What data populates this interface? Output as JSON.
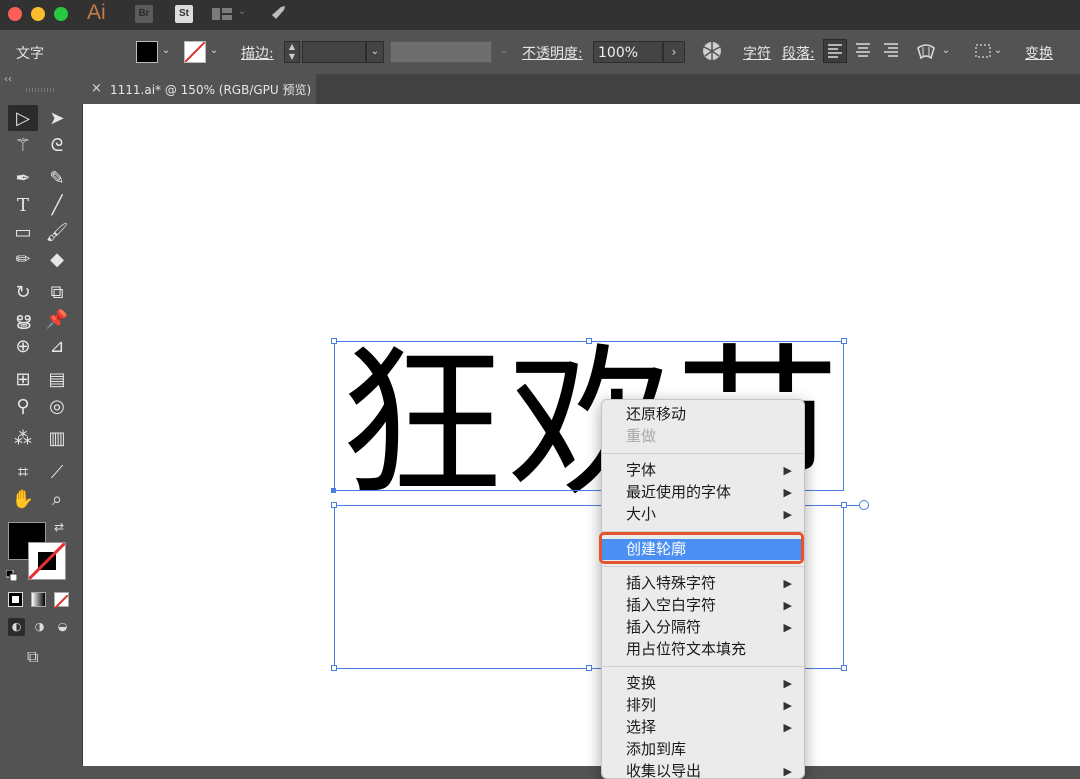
{
  "titlebar": {
    "app_logo": "Ai",
    "badges": [
      "Br",
      "St"
    ]
  },
  "controlbar": {
    "tool_label": "文字",
    "stroke_label": "描边:",
    "opacity_label": "不透明度:",
    "opacity_value": "100%",
    "character_label": "字符",
    "paragraph_label": "段落:",
    "transform_label": "变换",
    "colors": {
      "fill": "#000000",
      "stroke_none": "#ffffff",
      "slash": "#e0312b"
    }
  },
  "document": {
    "tab_close": "×",
    "tab_title": "1111.ai* @ 150% (RGB/GPU 预览)"
  },
  "canvas": {
    "text": "狂欢节"
  },
  "context_menu": {
    "groups": [
      [
        {
          "label": "还原移动",
          "submenu": false,
          "disabled": false
        },
        {
          "label": "重做",
          "submenu": false,
          "disabled": true
        }
      ],
      [
        {
          "label": "字体",
          "submenu": true
        },
        {
          "label": "最近使用的字体",
          "submenu": true
        },
        {
          "label": "大小",
          "submenu": true
        }
      ],
      [
        {
          "label": "创建轮廓",
          "submenu": false,
          "highlighted": true
        }
      ],
      [
        {
          "label": "插入特殊字符",
          "submenu": true
        },
        {
          "label": "插入空白字符",
          "submenu": true
        },
        {
          "label": "插入分隔符",
          "submenu": true
        },
        {
          "label": "用占位符文本填充",
          "submenu": false
        }
      ],
      [
        {
          "label": "变换",
          "submenu": true
        },
        {
          "label": "排列",
          "submenu": true
        },
        {
          "label": "选择",
          "submenu": true
        },
        {
          "label": "添加到库",
          "submenu": false
        },
        {
          "label": "收集以导出",
          "submenu": true
        }
      ]
    ],
    "submenu_arrow": "▶",
    "highlight_color": "#4a8ff1",
    "annotation_color": "#e6522c"
  }
}
